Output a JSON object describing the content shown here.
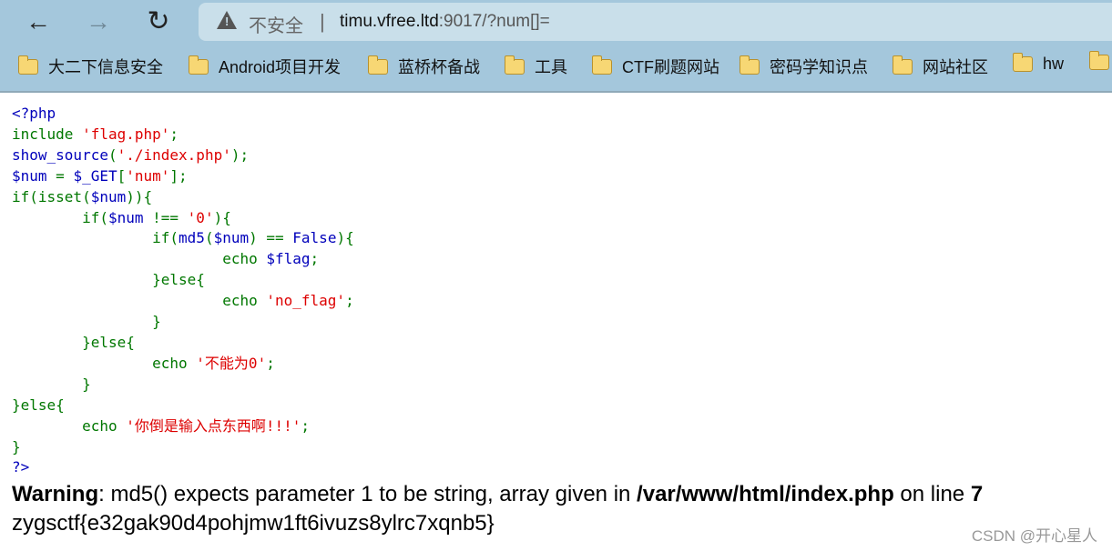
{
  "browser": {
    "nav": {
      "back_icon": "arrow-left",
      "forward_icon": "arrow-right",
      "reload_icon": "reload"
    },
    "address": {
      "security_label": "不安全",
      "url_host": "timu.vfree.ltd",
      "url_rest": ":9017/?num[]="
    },
    "bookmarks": [
      "大二下信息安全",
      "Android项目开发",
      "蓝桥杯备战",
      "工具",
      "CTF刷题网站",
      "密码学知识点",
      "网站社区",
      "hw"
    ]
  },
  "page": {
    "code_lines": [
      [
        [
          "v",
          "<?php"
        ]
      ],
      [
        [
          "k",
          "include "
        ],
        [
          "s",
          "'flag.php'"
        ],
        [
          "k",
          ";"
        ]
      ],
      [
        [
          "v",
          "show_source"
        ],
        [
          "k",
          "("
        ],
        [
          "s",
          "'./index.php'"
        ],
        [
          "k",
          ");"
        ]
      ],
      [
        [
          "v",
          "$num"
        ],
        [
          "k",
          " = "
        ],
        [
          "v",
          "$_GET"
        ],
        [
          "k",
          "["
        ],
        [
          "s",
          "'num'"
        ],
        [
          "k",
          "];"
        ]
      ],
      [
        [
          "k",
          "if(isset("
        ],
        [
          "v",
          "$num"
        ],
        [
          "k",
          ")){"
        ]
      ],
      [
        [
          "k",
          "\tif("
        ],
        [
          "v",
          "$num "
        ],
        [
          "k",
          "!== "
        ],
        [
          "s",
          "'0'"
        ],
        [
          "k",
          "){"
        ]
      ],
      [
        [
          "k",
          "\t\tif("
        ],
        [
          "v",
          "md5"
        ],
        [
          "k",
          "("
        ],
        [
          "v",
          "$num"
        ],
        [
          "k",
          ") == "
        ],
        [
          "v",
          "False"
        ],
        [
          "k",
          "){"
        ]
      ],
      [
        [
          "k",
          "\t\t\techo "
        ],
        [
          "v",
          "$flag"
        ],
        [
          "k",
          ";"
        ]
      ],
      [
        [
          "k",
          "\t\t}else{"
        ]
      ],
      [
        [
          "k",
          "\t\t\techo "
        ],
        [
          "s",
          "'no_flag'"
        ],
        [
          "k",
          ";"
        ]
      ],
      [
        [
          "k",
          "\t\t}"
        ]
      ],
      [
        [
          "k",
          "\t}else{"
        ]
      ],
      [
        [
          "k",
          "\t\techo "
        ],
        [
          "s",
          "'不能为0'"
        ],
        [
          "k",
          ";"
        ]
      ],
      [
        [
          "k",
          "\t}"
        ]
      ],
      [
        [
          "k",
          "}else{"
        ]
      ],
      [
        [
          "k",
          "\techo "
        ],
        [
          "s",
          "'你倒是输入点东西啊!!!'"
        ],
        [
          "k",
          ";"
        ]
      ],
      [
        [
          "k",
          "}"
        ]
      ],
      [
        [
          "v",
          "?>"
        ]
      ]
    ],
    "warning": {
      "label": "Warning",
      "text1": ": md5() expects parameter 1 to be string, array given in ",
      "file": "/var/www/html/index.php",
      "text2": " on line ",
      "line": "7"
    },
    "flag": "zygsctf{e32gak90d4pohjmw1ft6ivuzs8ylrc7xqnb5}",
    "watermark": "CSDN @开心星人"
  },
  "colors": {
    "keyword": "#007700",
    "identifier": "#0000BB",
    "string": "#DD0000",
    "toolbar": "#a4c7dc"
  }
}
